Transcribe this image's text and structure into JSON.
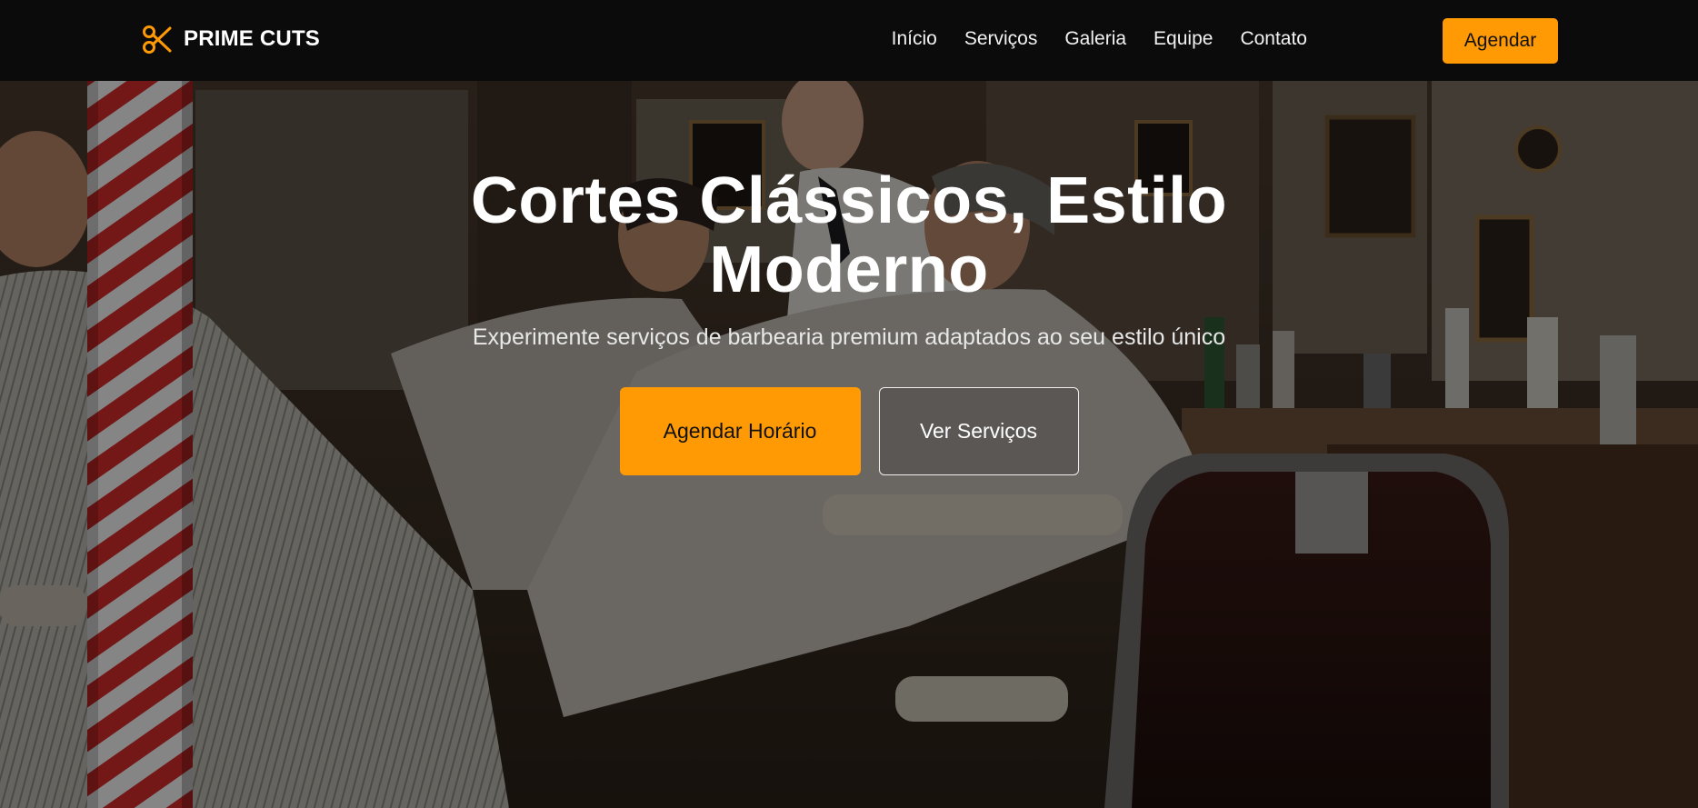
{
  "brand": {
    "name": "PRIME CUTS",
    "icon": "scissors-icon",
    "accent_color": "#ff9a04"
  },
  "nav": {
    "links": [
      {
        "label": "Início"
      },
      {
        "label": "Serviços"
      },
      {
        "label": "Galeria"
      },
      {
        "label": "Equipe"
      },
      {
        "label": "Contato"
      }
    ],
    "cta_label": "Agendar"
  },
  "hero": {
    "title": "Cortes Clássicos, Estilo Moderno",
    "subtitle": "Experimente serviços de barbearia premium adaptados ao seu estilo único",
    "primary_button": "Agendar Horário",
    "secondary_button": "Ver Serviços",
    "background": "barbershop-interior-photo"
  }
}
